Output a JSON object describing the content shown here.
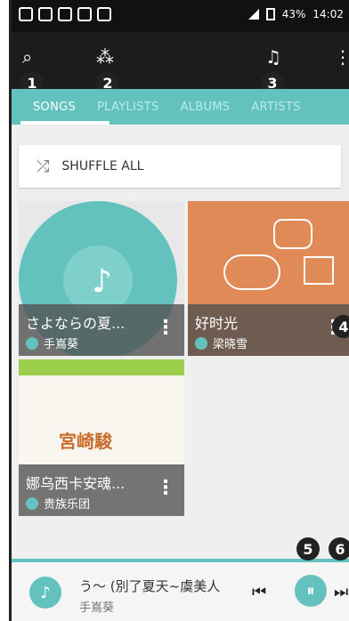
{
  "status_bar": {
    "battery": "43%",
    "time": "14:02"
  },
  "toolbar": {
    "search_icon": "search-icon",
    "shuffle_icon": "share-icon",
    "music_icon": "music-note-icon",
    "more_icon": "more-icon"
  },
  "tabs": [
    "SONGS",
    "PLAYLISTS",
    "ALBUMS",
    "ARTISTS"
  ],
  "callouts": [
    "1",
    "2",
    "3",
    "4",
    "5",
    "6"
  ],
  "shuffle": {
    "label": "SHUFFLE ALL"
  },
  "cards": [
    {
      "title": "さよならの夏...",
      "artist": "手嶌葵"
    },
    {
      "title": "好时光",
      "artist": "梁晓雪"
    },
    {
      "title": "娜乌西卡安魂...",
      "artist": "贵族乐团",
      "art_text": "宮崎駿"
    }
  ],
  "player": {
    "song": "う〜 (別了夏天~虞美人",
    "artist": "手嶌葵"
  },
  "colors": {
    "accent": "#63c2bd"
  }
}
